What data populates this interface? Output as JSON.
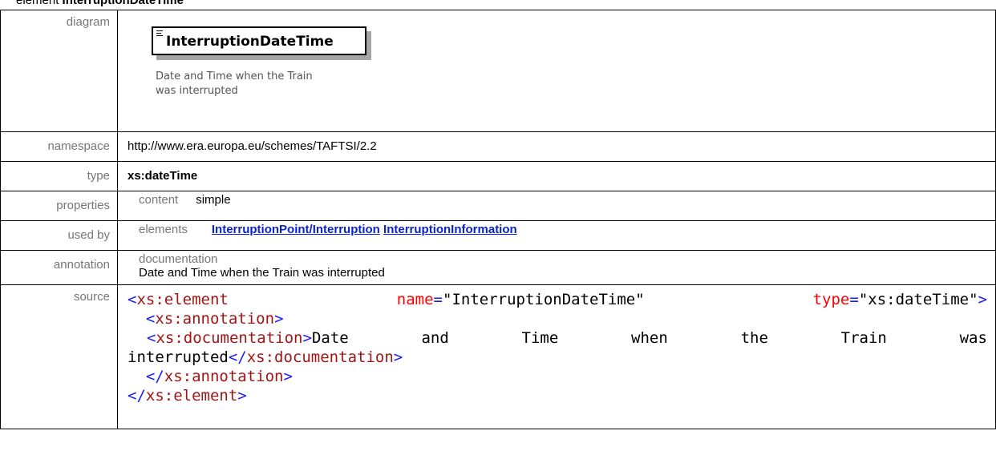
{
  "heading": {
    "prefix": "element",
    "name": "InterruptionDateTime"
  },
  "rows": {
    "diagram": {
      "label": "diagram",
      "node_name": "InterruptionDateTime",
      "node_doc_line1": "Date and Time when the Train",
      "node_doc_line2": "was interrupted"
    },
    "namespace": {
      "label": "namespace",
      "value": "http://www.era.europa.eu/schemes/TAFTSI/2.2"
    },
    "type": {
      "label": "type",
      "value": "xs:dateTime"
    },
    "properties": {
      "label": "properties",
      "key": "content",
      "value": "simple"
    },
    "used_by": {
      "label": "used by",
      "key": "elements",
      "link1": "InterruptionPoint/Interruption",
      "link2": "InterruptionInformation"
    },
    "annotation": {
      "label": "annotation",
      "key": "documentation",
      "value": "Date and Time when the Train was interrupted"
    },
    "source": {
      "label": "source",
      "l1_open": "<",
      "l1_tag": "xs:element",
      "l1_attr1": "name",
      "l1_val1": "\"InterruptionDateTime\"",
      "l1_attr2": "type",
      "l1_val2": "\"xs:dateTime\"",
      "l1_close": ">",
      "l2_tag": "xs:annotation",
      "l3_tag": "xs:documentation",
      "l3_words": [
        "Date",
        "and",
        "Time",
        "when",
        "the",
        "Train",
        "was"
      ],
      "l4_text": "interrupted",
      "l4_tag": "xs:documentation",
      "l5_tag": "xs:annotation",
      "l6_tag": "xs:element"
    }
  }
}
